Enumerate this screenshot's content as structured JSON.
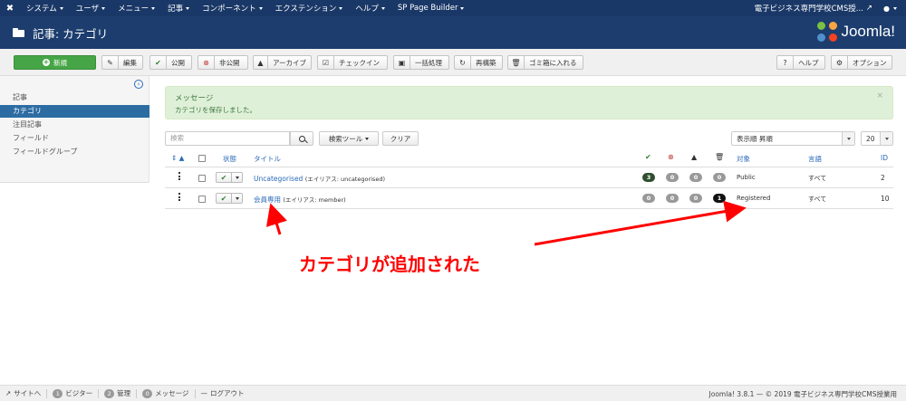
{
  "topnav": {
    "menu": [
      "システム",
      "ユーザ",
      "メニュー",
      "記事",
      "コンポーネント",
      "エクステンション",
      "ヘルプ",
      "SP Page Builder"
    ],
    "site_name": "電子ビジネス専門学校CMS授..."
  },
  "header": {
    "title": "記事: カテゴリ",
    "brand": "Joomla!"
  },
  "toolbar": {
    "new": "新規",
    "edit": "編集",
    "publish": "公開",
    "unpublish": "非公開",
    "archive": "アーカイブ",
    "checkin": "チェックイン",
    "batch": "一括処理",
    "rebuild": "再構築",
    "trash": "ゴミ箱に入れる",
    "help": "ヘルプ",
    "options": "オプション"
  },
  "sidebar": {
    "items": [
      {
        "label": "記事",
        "active": false
      },
      {
        "label": "カテゴリ",
        "active": true
      },
      {
        "label": "注目記事",
        "active": false
      },
      {
        "label": "フィールド",
        "active": false
      },
      {
        "label": "フィールドグループ",
        "active": false
      }
    ]
  },
  "message": {
    "heading": "メッセージ",
    "body": "カテゴリを保存しました。"
  },
  "filters": {
    "search_placeholder": "検索",
    "search_tools": "検索ツール",
    "clear": "クリア",
    "ordering": "表示順 昇順",
    "limit": "20"
  },
  "table": {
    "headers": {
      "status": "状態",
      "title": "タイトル",
      "access": "対象",
      "language": "言語",
      "id": "ID"
    },
    "rows": [
      {
        "title": "Uncategorised",
        "alias": "(エイリアス: uncategorised)",
        "published": "3",
        "unpublished": "0",
        "archived": "0",
        "trashed": "0",
        "access": "Public",
        "language": "すべて",
        "id": "2"
      },
      {
        "title": "会員専用",
        "alias": "(エイリアス: member)",
        "published": "0",
        "unpublished": "0",
        "archived": "0",
        "trashed": "1",
        "access": "Registered",
        "language": "すべて",
        "id": "10"
      }
    ]
  },
  "annotation": {
    "text": "カテゴリが追加された",
    "color": "#ff0000"
  },
  "footer": {
    "site": "サイトへ",
    "visitors_count": "1",
    "visitors": "ビジター",
    "admins_count": "2",
    "admins": "管理",
    "messages_count": "0",
    "messages": "メッセージ",
    "logout": "ログアウト",
    "copyright": "Joomla! 3.8.1 — © 2019 電子ビジネス専門学校CMS授業用"
  }
}
